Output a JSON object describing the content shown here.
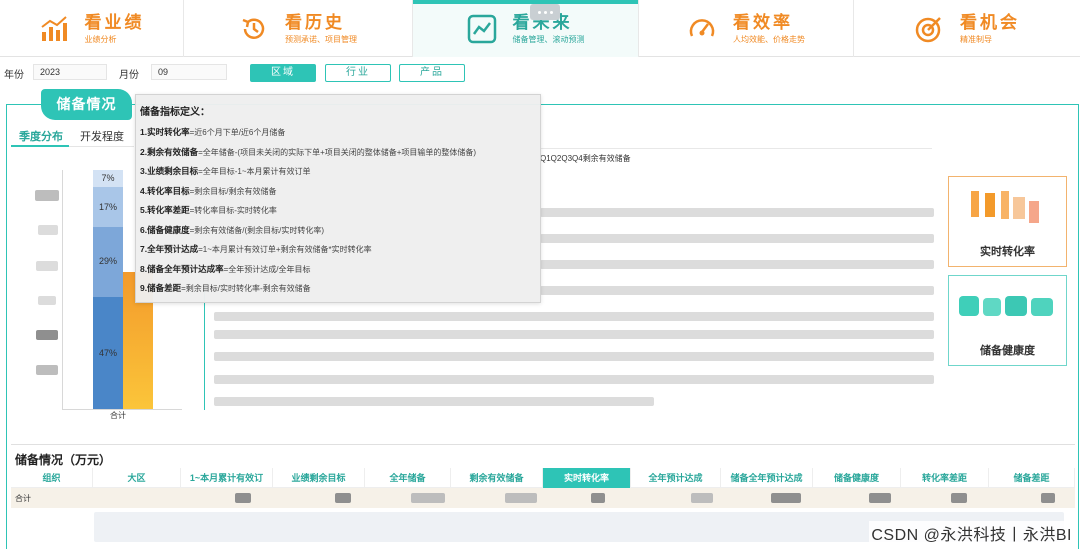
{
  "nav": {
    "tabs": [
      {
        "title": "看业绩",
        "sub": "业绩分析",
        "icon": "bar-chart-icon"
      },
      {
        "title": "看历史",
        "sub": "预测承诺、项目管理",
        "icon": "history-icon"
      },
      {
        "title": "看未来",
        "sub": "储备管理、滚动预测",
        "icon": "trend-icon",
        "active": true
      },
      {
        "title": "看效率",
        "sub": "人均效能、价格走势",
        "icon": "gauge-icon"
      },
      {
        "title": "看机会",
        "sub": "精准制导",
        "icon": "target-icon"
      }
    ]
  },
  "filters": {
    "year_label": "年份",
    "year_value": "2023",
    "month_label": "月份",
    "month_value": "09",
    "buttons": [
      {
        "label": "区域",
        "active": true
      },
      {
        "label": "行业",
        "active": false
      },
      {
        "label": "产品",
        "active": false
      }
    ]
  },
  "section": {
    "title": "储备情况",
    "tabs": [
      "季度分布",
      "开发程度"
    ]
  },
  "chart_data": {
    "type": "bar",
    "categories": [
      "合计"
    ],
    "series": [
      {
        "values": [
          47
        ]
      },
      {
        "values": [
          29
        ]
      },
      {
        "values": [
          17
        ]
      },
      {
        "values": [
          7
        ]
      }
    ],
    "labels": [
      "47%",
      "29%",
      "17%",
      "7%"
    ]
  },
  "tooltip": {
    "title": "储备指标定义：",
    "items": [
      {
        "term": "1.实时转化率",
        "def": "=近6个月下单/近6个月储备"
      },
      {
        "term": "2.剩余有效储备",
        "def": "=全年储备-(项目未关闭的实际下单+项目关闭的整体储备+项目输单的整体储备)"
      },
      {
        "term": "3.业绩剩余目标",
        "def": "=全年目标-1~本月累计有效订单"
      },
      {
        "term": "4.转化率目标",
        "def": "=剩余目标/剩余有效储备"
      },
      {
        "term": "5.转化率差距",
        "def": "=转化率目标-实时转化率"
      },
      {
        "term": "6.储备健康度",
        "def": "=剩余有效储备/(剩余目标/实时转化率)"
      },
      {
        "term": "7.全年预计达成",
        "def": "=1~本月累计有效订单+剩余有效储备*实时转化率"
      },
      {
        "term": "8.储备全年预计达成率",
        "def": "=全年预计达成/全年目标"
      },
      {
        "term": "9.储备差距",
        "def": "=剩余目标/实时转化率-剩余有效储备"
      }
    ]
  },
  "legend_text": "Q1Q2Q3Q4剩余有效储备",
  "kpis": [
    {
      "label": "实时转化率"
    },
    {
      "label": "储备健康度"
    }
  ],
  "table": {
    "title": "储备情况（万元）",
    "columns": [
      "组织",
      "大区",
      "1~本月累计有效订",
      "业绩剩余目标",
      "全年储备",
      "剩余有效储备",
      "实时转化率",
      "全年预计达成",
      "储备全年预计达成",
      "储备健康度",
      "转化率差距",
      "储备差距"
    ],
    "highlight_column": 6,
    "total_label": "合计"
  },
  "watermark": "CSDN @永洪科技丨永洪BI",
  "colors": {
    "accent": "#2ec4b6",
    "orange": "#f08a24",
    "bar_dark": "#4a86c8",
    "bar_mid": "#7da7d9",
    "bar_light": "#a9c6e8",
    "bar_lighter": "#d3e2f4"
  }
}
